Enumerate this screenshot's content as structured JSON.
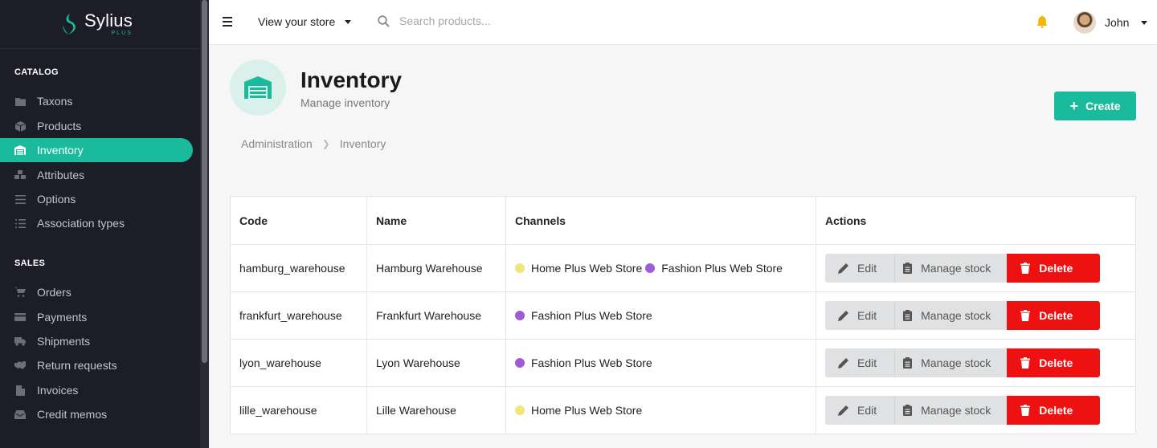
{
  "brand": {
    "name": "Sylius",
    "sub": "PLUS"
  },
  "sidebar": {
    "sections": [
      {
        "title": "CATALOG",
        "items": [
          {
            "label": "Taxons",
            "icon": "folder-icon"
          },
          {
            "label": "Products",
            "icon": "cube-icon"
          },
          {
            "label": "Inventory",
            "icon": "warehouse-icon",
            "active": true
          },
          {
            "label": "Attributes",
            "icon": "cubes-icon"
          },
          {
            "label": "Options",
            "icon": "sliders-icon"
          },
          {
            "label": "Association types",
            "icon": "list-icon"
          }
        ]
      },
      {
        "title": "SALES",
        "items": [
          {
            "label": "Orders",
            "icon": "cart-icon"
          },
          {
            "label": "Payments",
            "icon": "credit-card-icon"
          },
          {
            "label": "Shipments",
            "icon": "truck-icon"
          },
          {
            "label": "Return requests",
            "icon": "handshake-icon"
          },
          {
            "label": "Invoices",
            "icon": "file-icon"
          },
          {
            "label": "Credit memos",
            "icon": "inbox-icon"
          }
        ]
      }
    ]
  },
  "topbar": {
    "store_link": "View your store",
    "search_placeholder": "Search products...",
    "user_name": "John"
  },
  "header": {
    "title": "Inventory",
    "subtitle": "Manage inventory",
    "create_label": "Create",
    "breadcrumb": [
      "Administration",
      "Inventory"
    ]
  },
  "table": {
    "columns": [
      "Code",
      "Name",
      "Channels",
      "Actions"
    ],
    "rows": [
      {
        "code": "hamburg_warehouse",
        "name": "Hamburg Warehouse",
        "channels": [
          "Home Plus Web Store",
          "Fashion Plus Web Store"
        ]
      },
      {
        "code": "frankfurt_warehouse",
        "name": "Frankfurt Warehouse",
        "channels": [
          "Fashion Plus Web Store"
        ]
      },
      {
        "code": "lyon_warehouse",
        "name": "Lyon Warehouse",
        "channels": [
          "Fashion Plus Web Store"
        ]
      },
      {
        "code": "lille_warehouse",
        "name": "Lille Warehouse",
        "channels": [
          "Home Plus Web Store"
        ]
      }
    ],
    "actions": {
      "edit": "Edit",
      "manage_stock": "Manage stock",
      "delete": "Delete"
    }
  },
  "channel_colors": {
    "Home Plus Web Store": "#f0e77a",
    "Fashion Plus Web Store": "#a25bd6"
  },
  "colors": {
    "accent": "#1abb9c",
    "danger": "#ee1111",
    "sidebar_bg": "#1c1d26"
  }
}
